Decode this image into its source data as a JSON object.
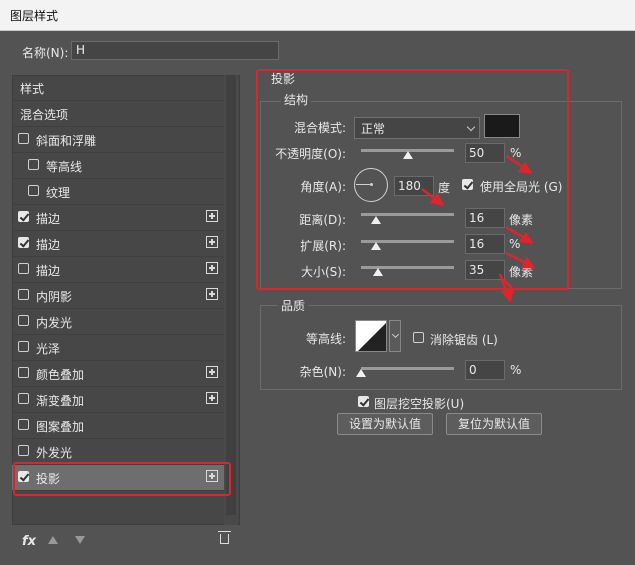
{
  "window": {
    "title": "图层样式"
  },
  "name_field": {
    "label": "名称(N):",
    "value": "H"
  },
  "sidebar": {
    "items": [
      {
        "label": "样式",
        "checkbox": false,
        "checked": false,
        "plus": false,
        "indent": 0
      },
      {
        "label": "混合选项",
        "checkbox": false,
        "checked": false,
        "plus": false,
        "indent": 0
      },
      {
        "label": "斜面和浮雕",
        "checkbox": true,
        "checked": false,
        "plus": false,
        "indent": 0
      },
      {
        "label": "等高线",
        "checkbox": true,
        "checked": false,
        "plus": false,
        "indent": 1
      },
      {
        "label": "纹理",
        "checkbox": true,
        "checked": false,
        "plus": false,
        "indent": 1
      },
      {
        "label": "描边",
        "checkbox": true,
        "checked": true,
        "plus": true,
        "indent": 0
      },
      {
        "label": "描边",
        "checkbox": true,
        "checked": true,
        "plus": true,
        "indent": 0
      },
      {
        "label": "描边",
        "checkbox": true,
        "checked": false,
        "plus": true,
        "indent": 0
      },
      {
        "label": "内阴影",
        "checkbox": true,
        "checked": false,
        "plus": true,
        "indent": 0
      },
      {
        "label": "内发光",
        "checkbox": true,
        "checked": false,
        "plus": false,
        "indent": 0
      },
      {
        "label": "光泽",
        "checkbox": true,
        "checked": false,
        "plus": false,
        "indent": 0
      },
      {
        "label": "颜色叠加",
        "checkbox": true,
        "checked": false,
        "plus": true,
        "indent": 0
      },
      {
        "label": "渐变叠加",
        "checkbox": true,
        "checked": false,
        "plus": true,
        "indent": 0
      },
      {
        "label": "图案叠加",
        "checkbox": true,
        "checked": false,
        "plus": false,
        "indent": 0
      },
      {
        "label": "外发光",
        "checkbox": true,
        "checked": false,
        "plus": false,
        "indent": 0
      },
      {
        "label": "投影",
        "checkbox": true,
        "checked": true,
        "plus": true,
        "indent": 0,
        "selected": true
      }
    ],
    "footer": {
      "fx": "fx"
    }
  },
  "drop_shadow": {
    "section_title": "投影",
    "structure_title": "结构",
    "blend_mode": {
      "label": "混合模式:",
      "value": "正常"
    },
    "opacity": {
      "label": "不透明度(O):",
      "value": "50",
      "unit": "%",
      "slider_fraction": 0.5
    },
    "angle": {
      "label": "角度(A):",
      "value": "180",
      "unit": "度",
      "global_light_label": "使用全局光 (G)",
      "global_light_checked": true
    },
    "distance": {
      "label": "距离(D):",
      "value": "16",
      "unit": "像素",
      "slider_fraction": 0.16
    },
    "spread": {
      "label": "扩展(R):",
      "value": "16",
      "unit": "%",
      "slider_fraction": 0.16
    },
    "size": {
      "label": "大小(S):",
      "value": "35",
      "unit": "像素",
      "slider_fraction": 0.18
    },
    "quality_title": "品质",
    "contour": {
      "label": "等高线:",
      "anti_alias_label": "消除锯齿 (L)",
      "anti_alias_checked": false
    },
    "noise": {
      "label": "杂色(N):",
      "value": "0",
      "unit": "%",
      "slider_fraction": 0.0
    },
    "knockout": {
      "label": "图层挖空投影(U)",
      "checked": true
    },
    "buttons": {
      "make_default": "设置为默认值",
      "reset_default": "复位为默认值"
    }
  },
  "colors": {
    "accent_red": "#e0242b",
    "panel": "#535353",
    "shadow_color": "#1a1a1a"
  }
}
